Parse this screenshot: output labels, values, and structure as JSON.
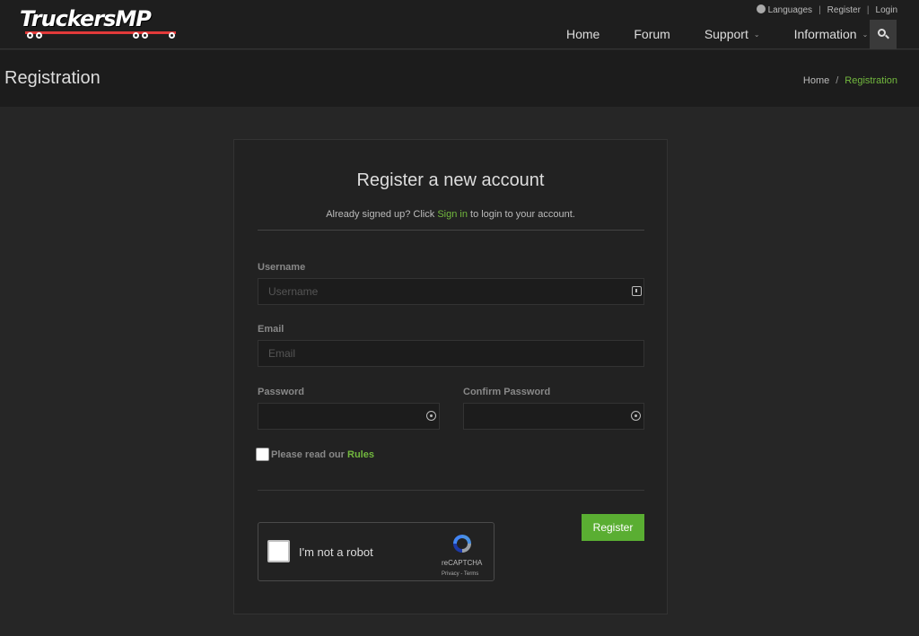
{
  "logo": {
    "text": "TruckersMP"
  },
  "top_links": {
    "languages": "Languages",
    "register": "Register",
    "login": "Login"
  },
  "nav": {
    "home": "Home",
    "forum": "Forum",
    "support": "Support",
    "information": "Information"
  },
  "page": {
    "title": "Registration",
    "breadcrumb": {
      "home": "Home",
      "current": "Registration"
    }
  },
  "form": {
    "heading": "Register a new account",
    "subtitle_before": "Already signed up? Click ",
    "subtitle_link": "Sign in",
    "subtitle_after": " to login to your account.",
    "username_label": "Username",
    "username_placeholder": "Username",
    "email_label": "Email",
    "email_placeholder": "Email",
    "password_label": "Password",
    "confirm_password_label": "Confirm Password",
    "rules_text": "Please read our ",
    "rules_link": "Rules",
    "register_button": "Register"
  },
  "recaptcha": {
    "label": "I'm not a robot",
    "brand": "reCAPTCHA",
    "links": "Privacy - Terms"
  },
  "colors": {
    "accent": "#72b83e",
    "button": "#5aae32",
    "background": "#262626"
  }
}
